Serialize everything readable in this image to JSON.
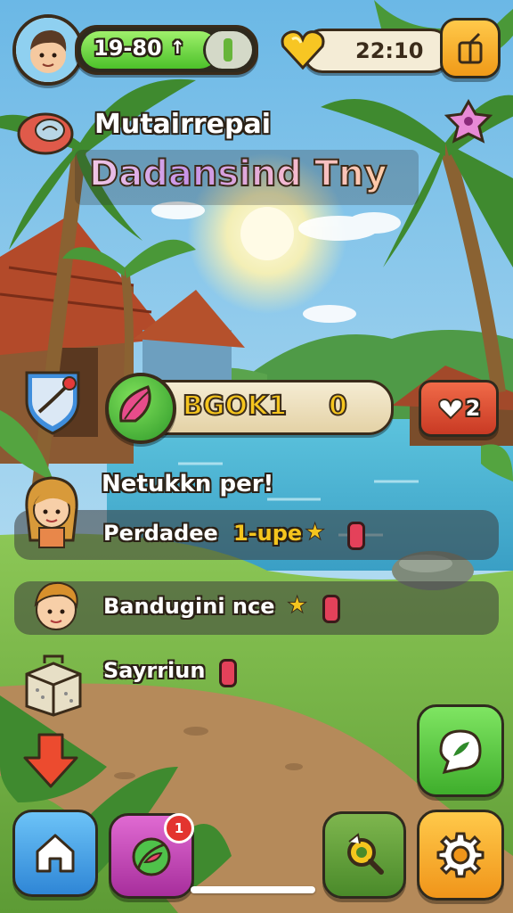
{
  "hud": {
    "energy_value": "19-80",
    "energy_unit": "↑",
    "energy_fill": 0.8,
    "gold_value": "22:10"
  },
  "header": {
    "subtitle": "Mutairrepai",
    "title": "Dadansind Tny"
  },
  "book": {
    "label": "BGOK1",
    "count": "0",
    "badge_value": "2"
  },
  "missions": {
    "heading": "Netukkn per!",
    "items": [
      {
        "label": "Perdadee",
        "highlight": "1-upe",
        "star": "★"
      },
      {
        "label": "Bandugini nce",
        "star": "★"
      },
      {
        "label": "Sayrriun"
      }
    ]
  },
  "bottom_bar": {
    "map_badge": "1"
  },
  "colors": {
    "sky_top": "#7fc4ea",
    "sky_bottom": "#cfeaf6",
    "water": "#4fb7d6",
    "grass": "#7cb94a",
    "path": "#b08456",
    "accent_orange": "#f3a31f",
    "accent_green": "#56c43b",
    "accent_blue": "#3f9ce6",
    "accent_pink": "#d04fbd",
    "accent_red": "#e4513c"
  },
  "icons": {
    "avatar": "boy-face-icon",
    "gold": "gold-heart-icon",
    "gift": "gift-box-icon",
    "shell": "shell-icon",
    "flower": "flower-icon",
    "shield": "shield-icon",
    "leaf": "leaf-icon",
    "badge": "heart-badge-icon",
    "mission_avatar_1": "girl-face-icon",
    "mission_avatar_2": "boy-face-icon",
    "box": "box-icon",
    "down_arrow": "down-arrow-icon",
    "chat": "chat-bubble-icon",
    "home": "home-icon",
    "map": "map-leaf-icon",
    "search": "search-icon",
    "settings": "gear-icon"
  }
}
